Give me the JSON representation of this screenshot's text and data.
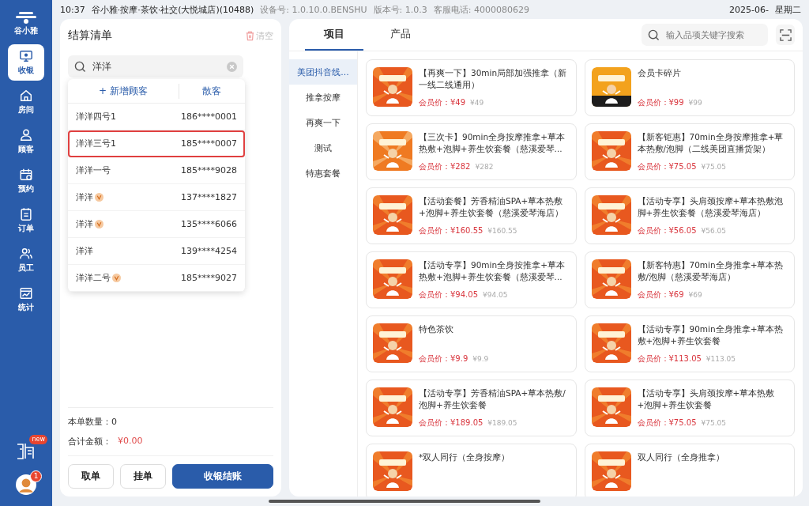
{
  "status_bar": {
    "time": "10:37",
    "store": "谷小雅·按摩·茶饮·社交(大悦城店)(10488)",
    "device": "设备号: 1.0.10.0.BENSHU",
    "version": "版本号: 1.0.3",
    "hotline": "客服电话: 4000080629",
    "date": "2025-06-",
    "weekday": "星期二"
  },
  "sidebar": {
    "logo": "谷小雅",
    "items": [
      {
        "label": "收银",
        "kind": "monitor",
        "selected": true
      },
      {
        "label": "房间",
        "kind": "home",
        "selected": false
      },
      {
        "label": "顾客",
        "kind": "person",
        "selected": false
      },
      {
        "label": "预约",
        "kind": "calendar",
        "selected": false
      },
      {
        "label": "订单",
        "kind": "order",
        "selected": false
      },
      {
        "label": "员工",
        "kind": "people",
        "selected": false
      },
      {
        "label": "统计",
        "kind": "chart",
        "selected": false
      }
    ],
    "promo_badge": "new",
    "avatar_badge": "1"
  },
  "checkout": {
    "title": "结算清单",
    "clear": "清空",
    "search": {
      "value": "洋洋"
    },
    "dropdown": {
      "add": "+ 新增顾客",
      "walk_in": "散客",
      "customers": [
        {
          "name": "洋洋四号1",
          "phone": "186****0001",
          "vip": false,
          "selected": false
        },
        {
          "name": "洋洋三号1",
          "phone": "185****0007",
          "vip": false,
          "selected": true
        },
        {
          "name": "洋洋一号",
          "phone": "185****9028",
          "vip": false,
          "selected": false
        },
        {
          "name": "洋洋",
          "phone": "137****1827",
          "vip": true,
          "selected": false
        },
        {
          "name": "洋洋",
          "phone": "135****6066",
          "vip": true,
          "selected": false
        },
        {
          "name": "洋洋",
          "phone": "139****4254",
          "vip": false,
          "selected": false
        },
        {
          "name": "洋洋二号",
          "phone": "185****9027",
          "vip": true,
          "selected": false
        }
      ]
    },
    "count_label": "本单数量：0",
    "total_label": "合计金额：",
    "total": "¥0.00",
    "buttons": [
      {
        "label": "取单",
        "kind": "plain"
      },
      {
        "label": "挂单",
        "kind": "plain"
      },
      {
        "label": "收银结账",
        "kind": "primary"
      }
    ]
  },
  "catalog": {
    "tabs": [
      {
        "label": "项目",
        "selected": true
      },
      {
        "label": "产品",
        "selected": false
      }
    ],
    "search": {
      "placeholder": "输入品项关键字搜索"
    },
    "categories": [
      {
        "label": "美团抖音线...",
        "selected": true
      },
      {
        "label": "推拿按摩",
        "selected": false
      },
      {
        "label": "再爽一下",
        "selected": false
      },
      {
        "label": "测试",
        "selected": false
      },
      {
        "label": "特惠套餐",
        "selected": false
      }
    ],
    "products": [
      {
        "title": "【再爽一下】30min局部加强推拿（新一线二线通用）",
        "member_price": "会员价：¥49",
        "price": "¥49"
      },
      {
        "title": "会员卡碎片",
        "member_price": "会员价：¥99",
        "price": "¥99"
      },
      {
        "title": "【三次卡】90min全身按摩推拿+草本热敷+泡脚+养生饮套餐（慈溪爱琴...",
        "member_price": "会员价：¥282",
        "price": "¥282"
      },
      {
        "title": "【新客钜惠】70min全身按摩推拿+草本热敷/泡脚（二线美团直播货架）",
        "member_price": "会员价：¥75.05",
        "price": "¥75.05"
      },
      {
        "title": "【活动套餐】芳香精油SPA+草本热敷+泡脚+养生饮套餐（慈溪爱琴海店）",
        "member_price": "会员价：¥160.55",
        "price": "¥160.55"
      },
      {
        "title": "【活动专享】头肩颈按摩+草本热敷泡脚+养生饮套餐（慈溪爱琴海店）",
        "member_price": "会员价：¥56.05",
        "price": "¥56.05"
      },
      {
        "title": "【活动专享】90min全身按推拿+草本热敷+泡脚+养生饮套餐（慈溪爱琴...",
        "member_price": "会员价：¥94.05",
        "price": "¥94.05"
      },
      {
        "title": "【新客特惠】70min全身推拿+草本热敷/泡脚（慈溪爱琴海店）",
        "member_price": "会员价：¥69",
        "price": "¥69"
      },
      {
        "title": "特色茶饮",
        "member_price": "会员价：¥9.9",
        "price": "¥9.9"
      },
      {
        "title": "【活动专享】90min全身推拿+草本热敷+泡脚+养生饮套餐",
        "member_price": "会员价：¥113.05",
        "price": "¥113.05"
      },
      {
        "title": "【活动专享】芳香精油SPA+草本热敷/泡脚+养生饮套餐",
        "member_price": "会员价：¥189.05",
        "price": "¥189.05"
      },
      {
        "title": "【活动专享】头肩颈按摩+草本热敷+泡脚+养生饮套餐",
        "member_price": "会员价：¥75.05",
        "price": "¥75.05"
      },
      {
        "title": "*双人同行（全身按摩）"
      },
      {
        "title": "双人同行（全身推拿）"
      }
    ]
  }
}
